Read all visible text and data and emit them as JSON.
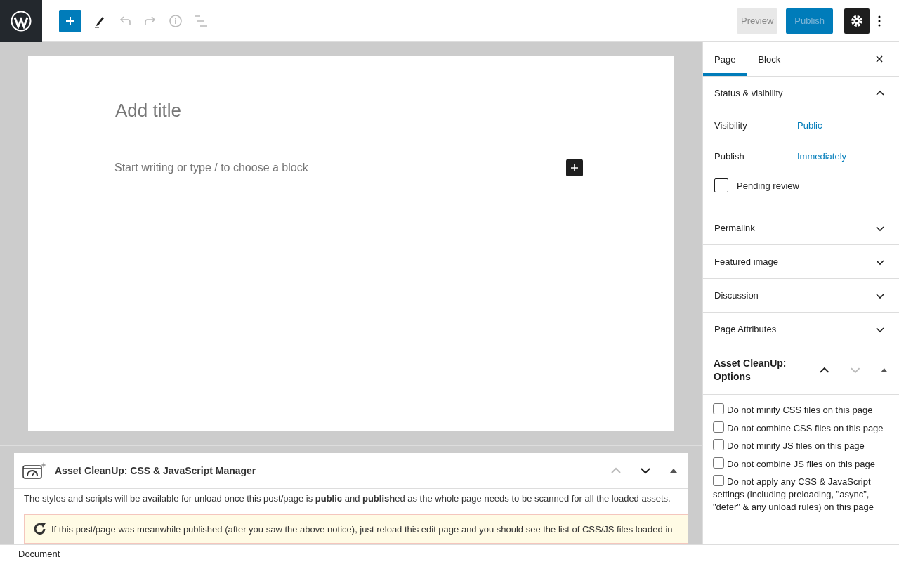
{
  "toolbar": {
    "preview": "Preview",
    "publish": "Publish",
    "settings_active": true
  },
  "editor": {
    "title_placeholder": "Add title",
    "body_placeholder": "Start writing or type / to choose a block"
  },
  "metabox": {
    "title": "Asset CleanUp: CSS & JavaScript Manager",
    "intro": "The styles and scripts will be available for unload once this post/page is **public** and **publish**ed as the whole page needs to be scanned for all the loaded assets.",
    "notice": "If this post/page was meanwhile published (after you saw the above notice), just reload this edit page and you should see the list of CSS/JS files loaded in"
  },
  "sidebar": {
    "tabs": [
      {
        "label": "Page",
        "selected": true
      },
      {
        "label": "Block",
        "selected": false
      }
    ],
    "panels": [
      {
        "title": "Status & visibility",
        "expanded": true,
        "rows": [
          {
            "label": "Visibility",
            "value": "Public"
          },
          {
            "label": "Publish",
            "value": "Immediately"
          }
        ],
        "pending": {
          "label": "Pending review",
          "checked": false
        }
      },
      {
        "title": "Permalink",
        "expanded": false
      },
      {
        "title": "Featured image",
        "expanded": false
      },
      {
        "title": "Discussion",
        "expanded": false
      },
      {
        "title": "Page Attributes",
        "expanded": false
      }
    ],
    "asset_box": {
      "title": "Asset CleanUp: Options",
      "options": [
        {
          "label": "Do not minify CSS files on this page",
          "checked": false
        },
        {
          "label": "Do not combine CSS files on this page",
          "checked": false
        },
        {
          "label": "Do not minify JS files on this page",
          "checked": false
        },
        {
          "label": "Do not combine JS files on this page",
          "checked": false
        },
        {
          "label": "Do not apply any CSS & JavaScript settings (including preloading, \"async\", \"defer\" & any unload rules) on this page",
          "checked": false
        }
      ]
    }
  },
  "footer": {
    "breadcrumb": "Document"
  }
}
